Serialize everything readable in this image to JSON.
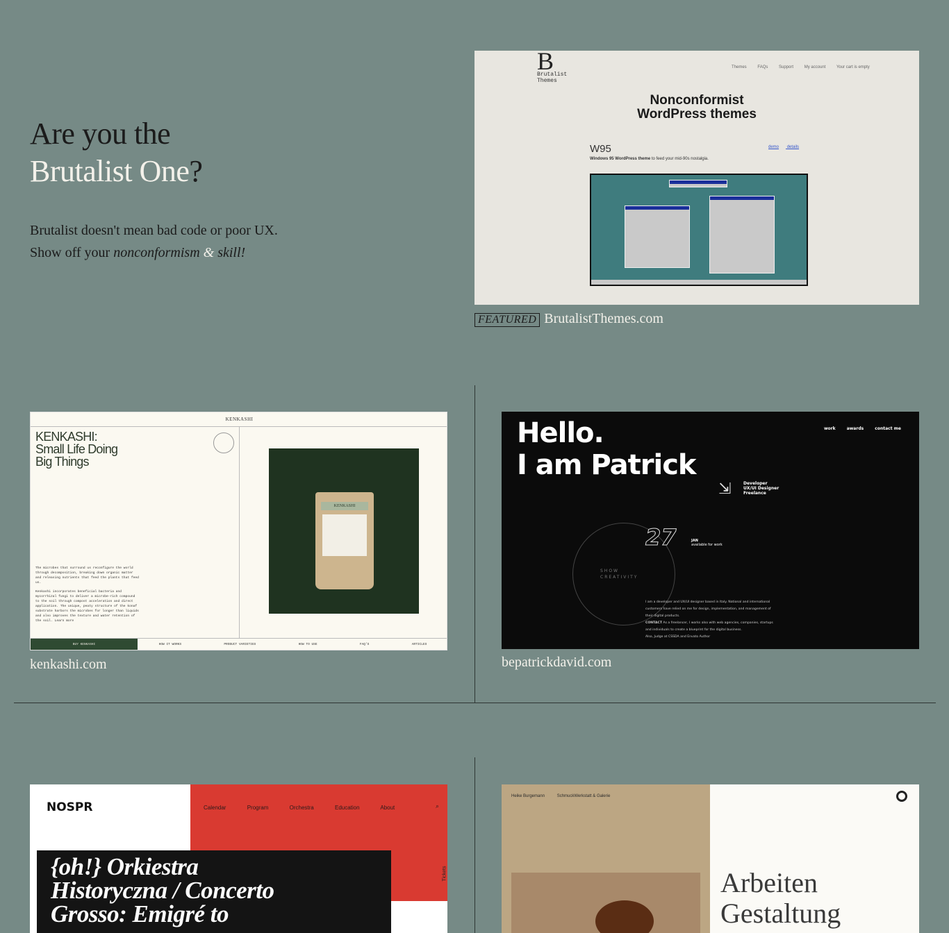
{
  "hero": {
    "title_line1": "Are you the",
    "title_line2": "Brutalist One",
    "title_mark": "?",
    "line1": "Brutalist doesn't mean bad code or poor UX.",
    "line2_prefix": "Show off your ",
    "line2_em": "nonconformism",
    "line2_amp": " & ",
    "line2_em2": "skill!"
  },
  "sites": [
    {
      "badge": "FEATURED",
      "caption": "BrutalistThemes.com",
      "shot": {
        "logo": "B",
        "logo_sub1": "Brutalist",
        "logo_sub2": "Themes",
        "nav": [
          "Themes",
          "FAQs",
          "Support",
          "My account",
          "Your cart is empty"
        ],
        "heading1": "Nonconformist",
        "heading2": "WordPress themes",
        "theme_name": "W95",
        "links": [
          "demo",
          "details"
        ],
        "theme_desc_bold": "Windows 95 WordPress theme",
        "theme_desc": " to feed your mid-90s nostalgia."
      }
    },
    {
      "caption": "kenkashi.com",
      "shot": {
        "brand": "KENKASHI",
        "heading1": "KENKASHI:",
        "heading2": "Small Life Doing",
        "heading3": "Big Things",
        "body1": "The microbes that surround us reconfigure the world through decomposition, breaking down organic matter and releasing nutrients that feed the plants that feed us.",
        "body2": "Kenkashi incorporates beneficial bacteria and mycorrhizal fungi to deliver a microbe-rich compound to the soil through compost acceleration and direct application. The unique, peaty structure of the konaf substrate harbors the microbes for longer than liquids and also improves the texture and water retention of the soil. Learn more",
        "bag_label": "KENKASHI",
        "buy": "BUY KENKASHI",
        "nav": [
          "HOW IT WORKS",
          "PRODUCT VARIETIES",
          "HOW TO USE",
          "FAQ'S",
          "ARTICLES"
        ]
      }
    },
    {
      "caption": "bepatrickdavid.com",
      "shot": {
        "hello": "Hello.",
        "name": "I am Patrick",
        "nav": [
          "work",
          "awards",
          "contact me"
        ],
        "role1": "Developer",
        "role2": "UX/UI Designer",
        "role3": "Freelance",
        "day": "27",
        "month": "JAN",
        "availability": "available for work",
        "ring1": "SHOW",
        "ring2": "CREATIVITY",
        "bio": "I am a developer and UX/UI designer based in Italy. National and international customers have relied on me for design, implementation, and management of their digital products.",
        "contact_label": "CONTACT",
        "contact_text": " As a freelancer, I works also with web agencies, companies, startups and individuals to create a blueprint for the digital business.",
        "judge": "Also, Judge at CSSDA and Envato Author"
      }
    },
    {
      "caption": "",
      "shot": {
        "logo": "NOSPR",
        "nav": [
          "Calendar",
          "Program",
          "Orchestra",
          "Education",
          "About"
        ],
        "title1": "{oh!} Orkiestra",
        "title2": "Historyczna / Concerto",
        "title3": "Grosso: Emigré to",
        "tickets": "Tickets"
      }
    },
    {
      "caption": "",
      "shot": {
        "nav": [
          "Heike Burgemann",
          "SchmuckWerkstatt & Galerie"
        ],
        "title1": "Arbeiten",
        "title2": "Gestaltung"
      }
    }
  ],
  "colors": {
    "background": "#768a86",
    "light_text": "#f3f1ea",
    "dark_text": "#1b1b1b"
  }
}
